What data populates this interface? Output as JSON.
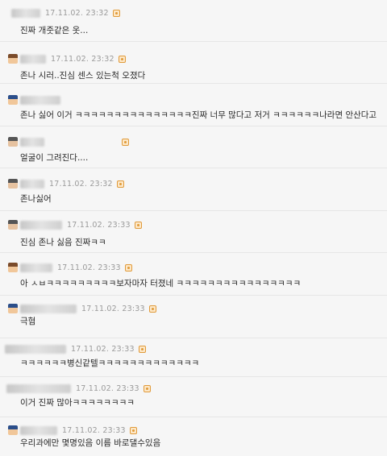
{
  "comments": [
    {
      "date": "17.11.02. 23:32",
      "text": "진짜 개줏같은 옷..."
    },
    {
      "date": "17.11.02. 23:32",
      "text": "존나 시러..진심 센스 있는척 오졌다"
    },
    {
      "date": "17.11.02. 23:32",
      "text": "존나 싫어 이거 ㅋㅋㅋㅋㅋㅋㅋㅋㅋㅋㅋㅋㅋㅋㅋ진짜 너무 많다고 저거 ㅋㅋㅋㅋㅋㅋ나라면 안산다고"
    },
    {
      "date": "17.11.02. 23:32",
      "text": "얼굴이 그려진다...."
    },
    {
      "date": "17.11.02. 23:32",
      "text": "존나싫어"
    },
    {
      "date": "17.11.02. 23:33",
      "text": "진심 존나 싫음 진짜ㅋㅋ"
    },
    {
      "date": "17.11.02. 23:33",
      "text": "아 ㅅㅂㅋㅋㅋㅋㅋㅋㅋㅋㅋ보자마자 터졌네 ㅋㅋㅋㅋㅋㅋㅋㅋㅋㅋㅋㅋㅋㅋㅋㅋ"
    },
    {
      "date": "17.11.02. 23:33",
      "text": "극혐"
    },
    {
      "date": "17.11.02. 23:33",
      "text": "ㅋㅋㅋㅋㅋㅋ병신같텔ㅋㅋㅋㅋㅋㅋㅋㅋㅋㅋㅋㅋㅋ"
    },
    {
      "date": "17.11.02. 23:33",
      "text": "이거 진짜 많아ㅋㅋㅋㅋㅋㅋㅋㅋ"
    },
    {
      "date": "17.11.02. 23:33",
      "text": "우리과에만 몇명있음 이름 바로댈수있음"
    }
  ]
}
